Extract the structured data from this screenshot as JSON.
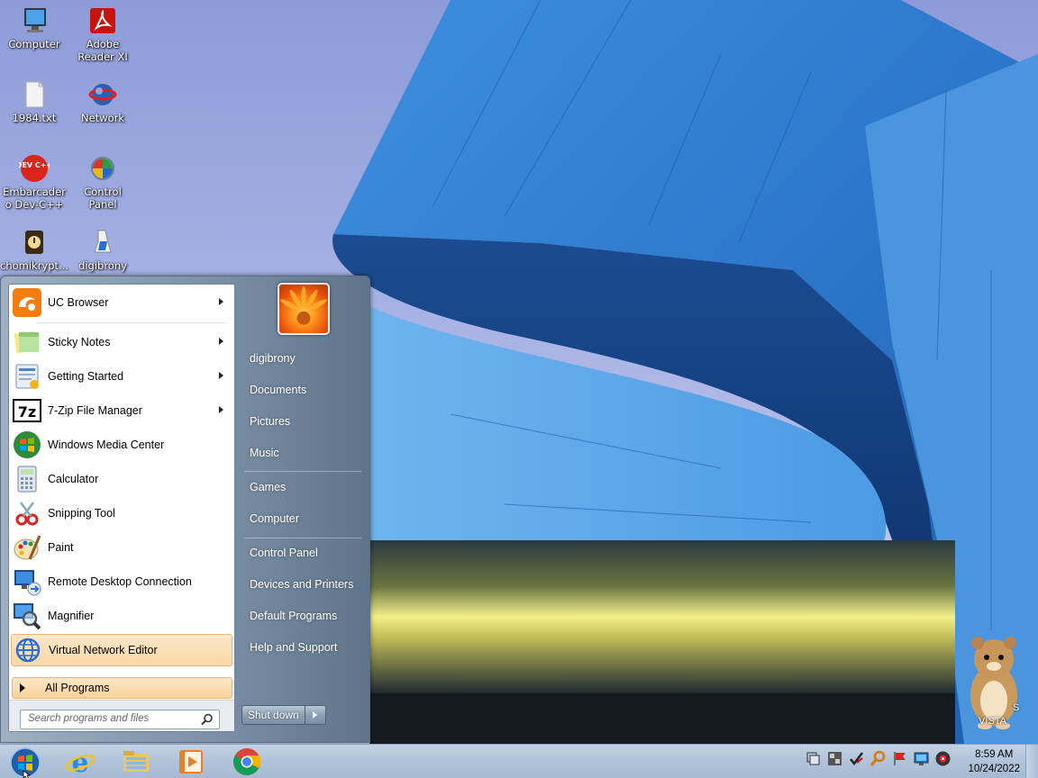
{
  "desktop": {
    "icons": [
      {
        "label": "Computer"
      },
      {
        "label": "Adobe Reader XI"
      },
      {
        "label": "1984.txt"
      },
      {
        "label": "Network"
      },
      {
        "label": "Embarcadero Dev-C++"
      },
      {
        "label": "Control Panel"
      },
      {
        "label": "chomikrypt..."
      },
      {
        "label": "digibrony"
      }
    ],
    "devcpp_icon_text": "DEV C++"
  },
  "start_menu": {
    "programs": [
      {
        "label": "UC Browser",
        "has_submenu": true
      },
      {
        "label": "Sticky Notes",
        "has_submenu": true
      },
      {
        "label": "Getting Started",
        "has_submenu": true
      },
      {
        "label": "7-Zip File Manager",
        "has_submenu": true
      },
      {
        "label": "Windows Media Center",
        "has_submenu": false
      },
      {
        "label": "Calculator",
        "has_submenu": false
      },
      {
        "label": "Snipping Tool",
        "has_submenu": false
      },
      {
        "label": "Paint",
        "has_submenu": false
      },
      {
        "label": "Remote Desktop Connection",
        "has_submenu": false
      },
      {
        "label": "Magnifier",
        "has_submenu": false
      },
      {
        "label": "Virtual Network Editor",
        "has_submenu": false
      }
    ],
    "zip_icon_text": "7z",
    "all_programs": "All Programs",
    "search_placeholder": "Search programs and files",
    "right_links": [
      {
        "label": "digibrony"
      },
      {
        "label": "Documents"
      },
      {
        "label": "Pictures"
      },
      {
        "label": "Music"
      },
      {
        "label": "Games"
      },
      {
        "label": "Computer"
      },
      {
        "label": "Control Panel"
      },
      {
        "label": "Devices and Printers"
      },
      {
        "label": "Default Programs"
      },
      {
        "label": "Help and Support"
      }
    ],
    "shutdown_label": "Shut down"
  },
  "taskbar": {
    "clock_time": "8:59 AM",
    "clock_date": "10/24/2022"
  },
  "gadget": {
    "text_vista": "VISTA",
    "text_s": "S"
  },
  "colors": {
    "highlight": "#fbd7a6",
    "taskbar": "#b0c3d9",
    "menu_right": "#7d92a8"
  }
}
